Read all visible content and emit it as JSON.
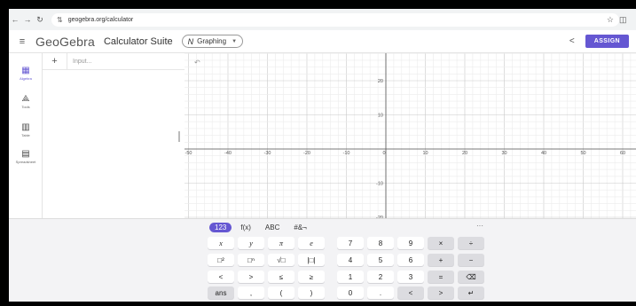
{
  "browser": {
    "url": "geogebra.org/calculator",
    "back_icon": "←",
    "forward_icon": "→",
    "reload_icon": "↻",
    "tune_icon": "⇅",
    "star_icon": "☆",
    "extension_icon": "◫"
  },
  "header": {
    "menu_icon": "≡",
    "brand": "GeoGebra",
    "suite": "Calculator Suite",
    "app_icon": "N",
    "app_label": "Graphing",
    "chevron": "▼",
    "share_icon": "<",
    "assign_label": "ASSIGN"
  },
  "rail": [
    {
      "glyph": "▦",
      "label": "Algebra",
      "active": true
    },
    {
      "glyph": "⟁",
      "label": "Tools",
      "active": false
    },
    {
      "glyph": "▥",
      "label": "Table",
      "active": false
    },
    {
      "glyph": "▤",
      "label": "Spreadsheet",
      "active": false
    }
  ],
  "algebra": {
    "plus": "+",
    "input_placeholder": "Input..."
  },
  "graphics": {
    "undo_icon": "↶",
    "x_ticks": [
      "-50",
      "-40",
      "-30",
      "-20",
      "-10",
      "0",
      "10",
      "20",
      "30",
      "40",
      "50",
      "60"
    ],
    "y_ticks": [
      "20",
      "10",
      "-10",
      "-20"
    ]
  },
  "keyboard": {
    "tabs": [
      "123",
      "f(x)",
      "ABC",
      "#&¬"
    ],
    "more": "···",
    "rows": [
      [
        "x",
        "y",
        "π",
        "e",
        "7",
        "8",
        "9",
        "×",
        "÷"
      ],
      [
        "□²",
        "□ⁿ",
        "√□",
        "|□|",
        "4",
        "5",
        "6",
        "+",
        "−"
      ],
      [
        "<",
        ">",
        "≤",
        "≥",
        "1",
        "2",
        "3",
        "=",
        "⌫"
      ],
      [
        "ans",
        ",",
        "(",
        ")",
        "0",
        ".",
        "<",
        ">",
        "↵"
      ]
    ]
  }
}
